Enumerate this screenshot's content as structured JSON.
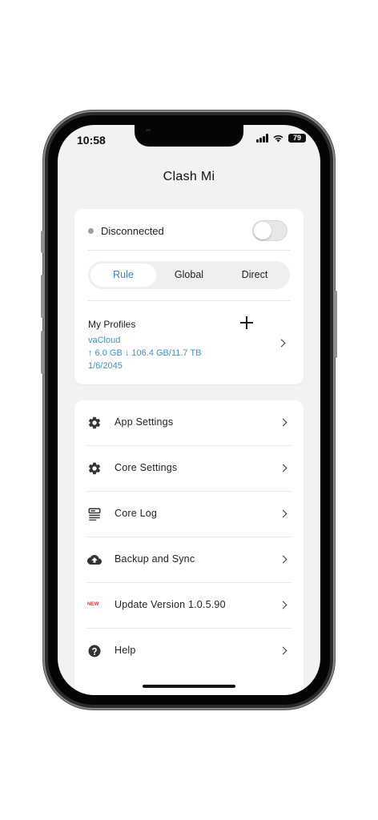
{
  "status": {
    "time": "10:58",
    "battery": "79"
  },
  "app": {
    "title": "Clash Mi"
  },
  "connection": {
    "status": "Disconnected",
    "enabled": false
  },
  "mode": {
    "options": [
      "Rule",
      "Global",
      "Direct"
    ],
    "selected": "Rule"
  },
  "profiles": {
    "heading": "My Profiles",
    "name": "vaCloud",
    "usage": "↑ 6.0 GB ↓ 106.4 GB/11.7 TB",
    "expiry": "1/6/2045"
  },
  "menu": {
    "items": [
      {
        "label": "App Settings",
        "icon": "gear-icon"
      },
      {
        "label": "Core Settings",
        "icon": "gear-icon"
      },
      {
        "label": "Core Log",
        "icon": "log-icon"
      },
      {
        "label": "Backup and Sync",
        "icon": "cloud-upload-icon"
      },
      {
        "label": "Update Version 1.0.5.90",
        "icon": "new-badge-icon",
        "badge": "NEW"
      },
      {
        "label": "Help",
        "icon": "help-icon"
      }
    ]
  },
  "colors": {
    "accent": "#3d7fd6",
    "link": "#3d8fd6",
    "background": "#f2f2f2",
    "badge": "#e53935"
  }
}
